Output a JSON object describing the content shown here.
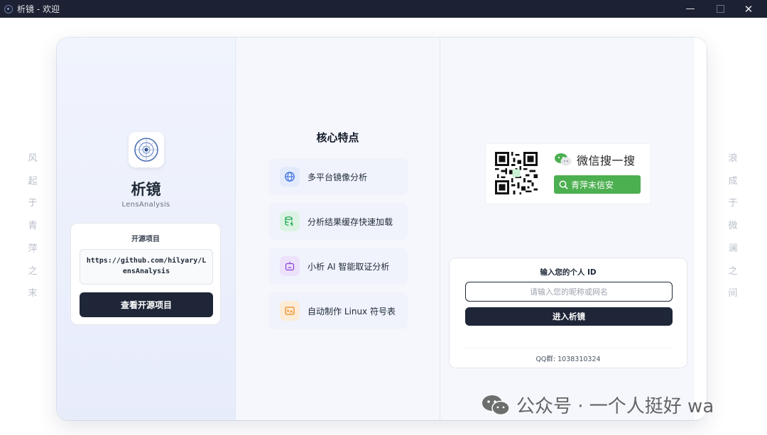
{
  "window": {
    "title": "析镜 - 欢迎",
    "controls": {
      "minimize": "—",
      "close": "✕"
    }
  },
  "poems": {
    "left": [
      "风",
      "起",
      "于",
      "青",
      "萍",
      "之",
      "末"
    ],
    "right": [
      "浪",
      "成",
      "于",
      "微",
      "澜",
      "之",
      "间"
    ]
  },
  "brand": {
    "name": "析镜",
    "subtitle": "LensAnalysis"
  },
  "open_source": {
    "title": "开源项目",
    "url": "https://github.com/hilyary/LensAnalysis",
    "button_label": "查看开源项目"
  },
  "features": {
    "title": "核心特点",
    "items": [
      {
        "label": "多平台镜像分析",
        "icon": "globe-icon",
        "color": "#3b6fe0",
        "bg": "#e3eafb"
      },
      {
        "label": "分析结果缓存快速加载",
        "icon": "database-lightning-icon",
        "color": "#16a34a",
        "bg": "#dcf3e4"
      },
      {
        "label": "小析 AI 智能取证分析",
        "icon": "robot-icon",
        "color": "#8b3fd9",
        "bg": "#ece2fb"
      },
      {
        "label": "自动制作 Linux 符号表",
        "icon": "terminal-image-icon",
        "color": "#ea8a1a",
        "bg": "#fcebd6"
      }
    ]
  },
  "wechat_ad": {
    "label": "微信搜一搜",
    "search_text": "青萍末信安",
    "accent": "#4caf50"
  },
  "login": {
    "title": "输入您的个人 ID",
    "placeholder": "请输入您的昵称或网名",
    "value": "",
    "button_label": "进入析镜",
    "qq_group": "QQ群: 1038310324"
  },
  "watermark": {
    "text": "公众号 · 一个人挺好 wa"
  },
  "colors": {
    "titlebar": "#1c2233",
    "primary_button": "#1e2638"
  }
}
